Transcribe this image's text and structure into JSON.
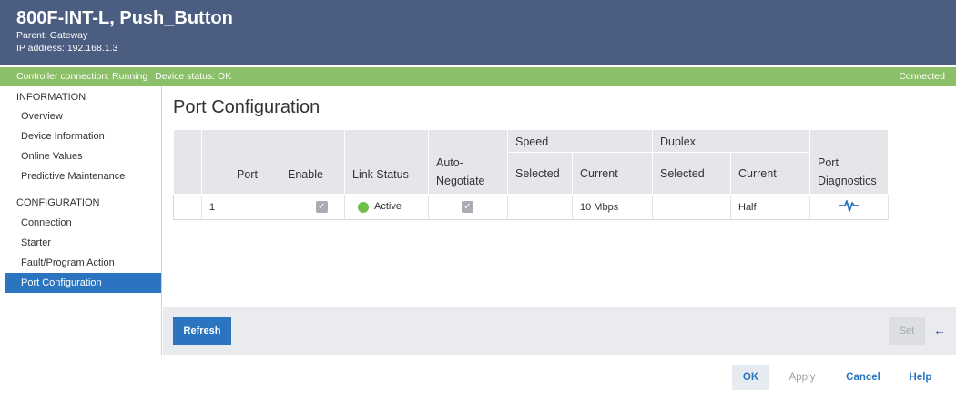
{
  "header": {
    "title": "800F-INT-L, Push_Button",
    "parent": "Parent: Gateway",
    "ip": "IP address: 192.168.1.3"
  },
  "status": {
    "controller": "Controller connection: Running",
    "device": "Device status: OK",
    "connection": "Connected"
  },
  "sidebar": {
    "info_heading": "INFORMATION",
    "info_items": [
      "Overview",
      "Device Information",
      "Online Values",
      "Predictive Maintenance"
    ],
    "config_heading": "CONFIGURATION",
    "config_items": [
      "Connection",
      "Starter",
      "Fault/Program Action",
      "Port Configuration"
    ],
    "active_item": "Port Configuration"
  },
  "main": {
    "page_title": "Port Configuration",
    "table": {
      "headers": {
        "port": "Port",
        "enable": "Enable",
        "link_status": "Link Status",
        "auto_negotiate": "Auto-Negotiate",
        "speed": "Speed",
        "duplex": "Duplex",
        "selected": "Selected",
        "current": "Current",
        "port_diagnostics": "Port Diagnostics"
      },
      "rows": [
        {
          "port": "1",
          "enable": true,
          "link_status": "Active",
          "auto_negotiate": true,
          "speed_selected": "",
          "speed_current": "10 Mbps",
          "duplex_selected": "",
          "duplex_current": "Half",
          "diagnostics_icon": "pulse-icon"
        }
      ]
    }
  },
  "actions": {
    "refresh": "Refresh",
    "set": "Set"
  },
  "footer": {
    "ok": "OK",
    "apply": "Apply",
    "cancel": "Cancel",
    "help": "Help"
  },
  "colors": {
    "header_bg": "#4b5d80",
    "status_bg": "#8cc068",
    "accent": "#2a74c0",
    "active_dot": "#6fc14e"
  }
}
